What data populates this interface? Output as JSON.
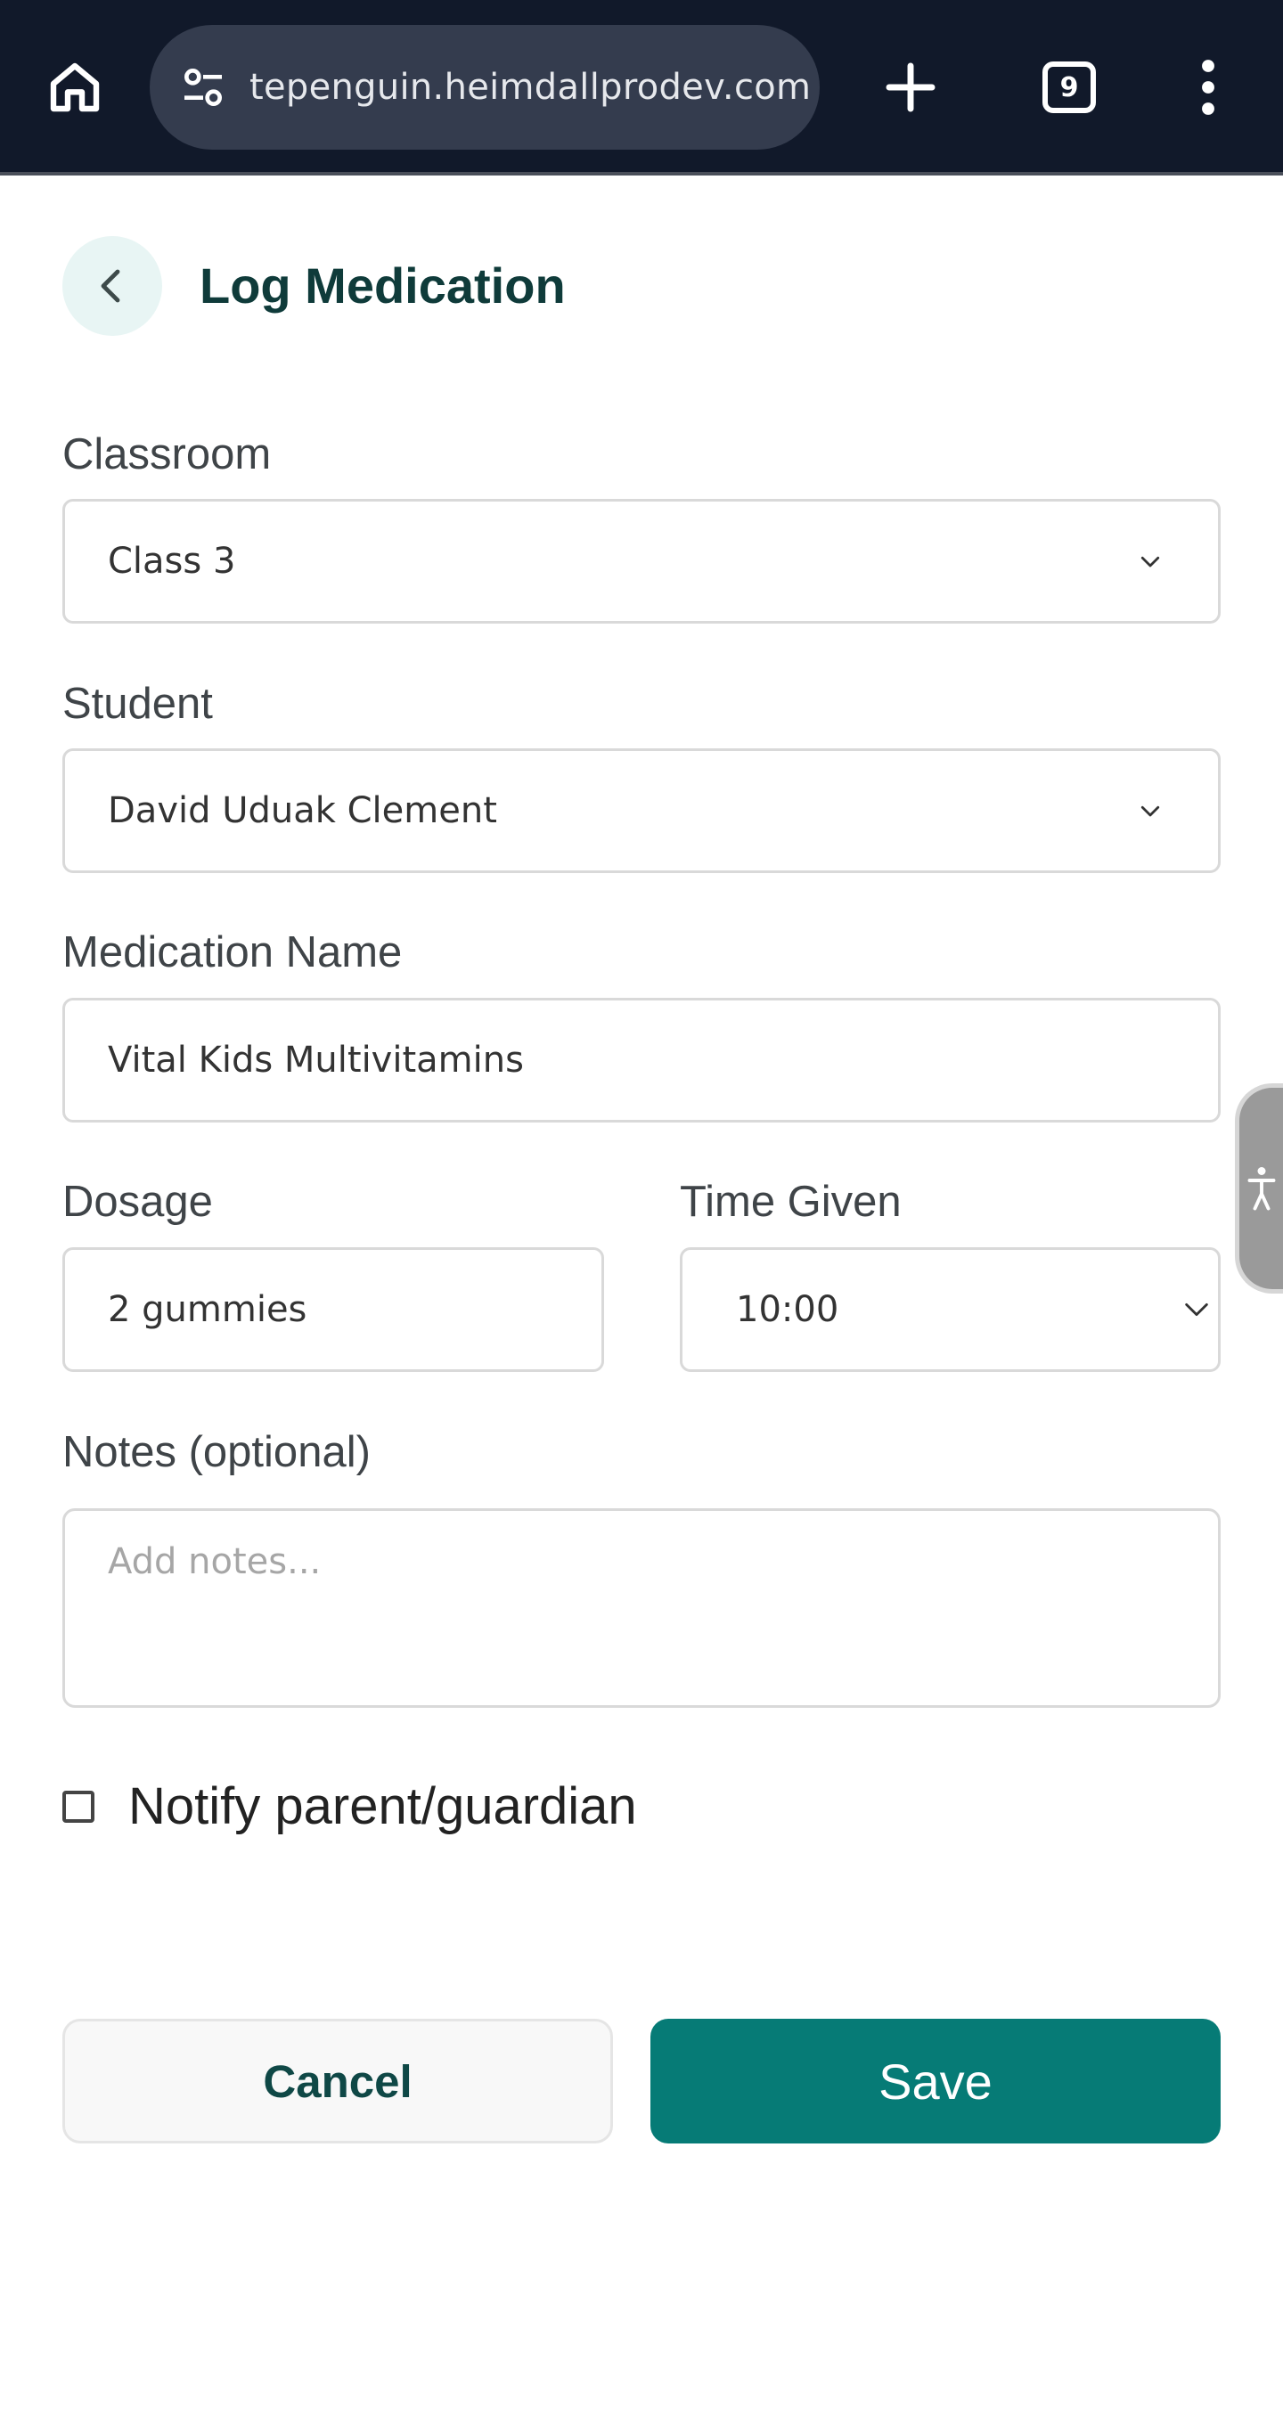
{
  "browser": {
    "url": "tepenguin.heimdallprodev.com",
    "tab_count": "9"
  },
  "header": {
    "title": "Log Medication"
  },
  "form": {
    "classroom": {
      "label": "Classroom",
      "value": "Class 3"
    },
    "student": {
      "label": "Student",
      "value": "David Uduak Clement"
    },
    "medication_name": {
      "label": "Medication Name",
      "value": "Vital Kids Multivitamins"
    },
    "dosage": {
      "label": "Dosage",
      "value": "2 gummies"
    },
    "time_given": {
      "label": "Time Given",
      "value": "10:00"
    },
    "notes": {
      "label": "Notes (optional)",
      "placeholder": "Add notes..."
    },
    "notify": {
      "label": "Notify parent/guardian",
      "checked": false
    }
  },
  "actions": {
    "cancel_label": "Cancel",
    "save_label": "Save"
  },
  "colors": {
    "browser_bar": "#11192a",
    "accent": "#067b76",
    "title": "#0f3b3a"
  },
  "icons": [
    "home-icon",
    "site-settings-icon",
    "plus-icon",
    "tab-switcher-icon",
    "more-vert-icon",
    "chevron-left-icon",
    "chevron-down-icon",
    "accessibility-icon"
  ]
}
